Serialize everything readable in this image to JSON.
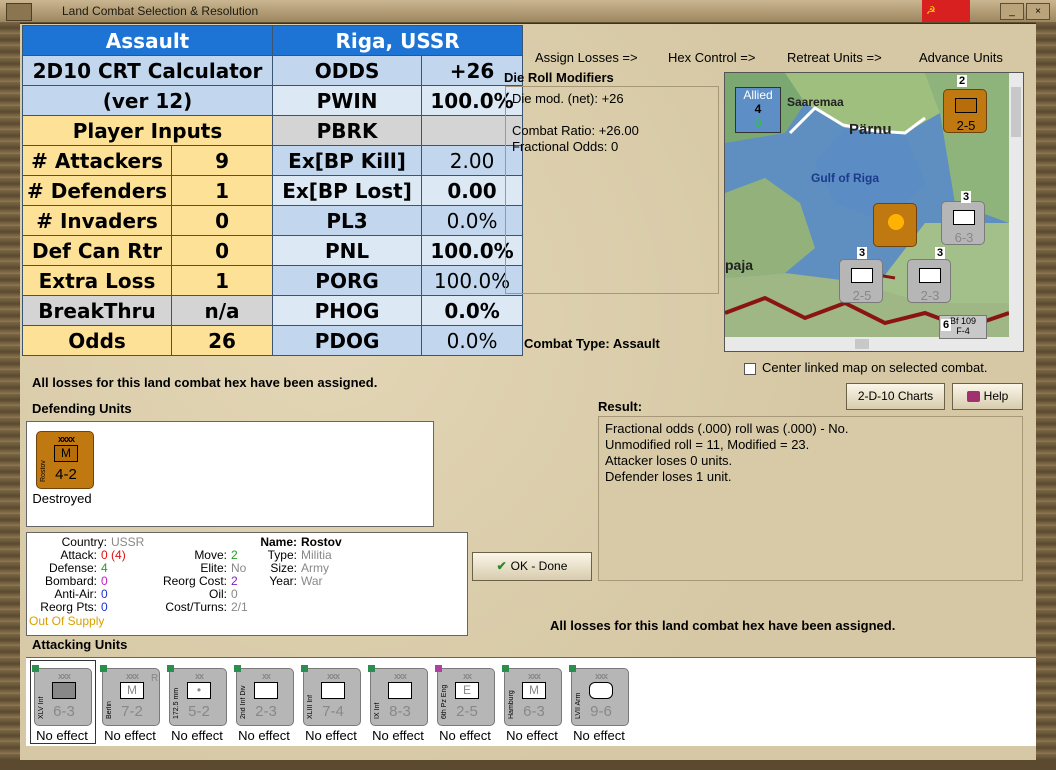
{
  "window": {
    "title": "Land Combat Selection & Resolution"
  },
  "crt": {
    "assault": "Assault",
    "location": "Riga, USSR",
    "title1": "2D10 CRT Calculator",
    "title2": "(ver 12)",
    "player_inputs": "Player Inputs",
    "left_rows": [
      {
        "label": "# Attackers",
        "value": "9"
      },
      {
        "label": "# Defenders",
        "value": "1"
      },
      {
        "label": "# Invaders",
        "value": "0"
      },
      {
        "label": "Def Can Rtr",
        "value": "0"
      },
      {
        "label": "Extra Loss",
        "value": "1"
      },
      {
        "label": "BreakThru",
        "value": "n/a"
      },
      {
        "label": "Odds",
        "value": "26"
      }
    ],
    "right_rows": [
      {
        "label": "ODDS",
        "value": "+26"
      },
      {
        "label": "PWIN",
        "value": "100.0%"
      },
      {
        "label": "PBRK",
        "value": ""
      },
      {
        "label": "Ex[BP Kill]",
        "value": "2.00"
      },
      {
        "label": "Ex[BP Lost]",
        "value": "0.00"
      },
      {
        "label": "PL3",
        "value": "0.0%"
      },
      {
        "label": "PNL",
        "value": "100.0%"
      },
      {
        "label": "PORG",
        "value": "100.0%"
      },
      {
        "label": "PHOG",
        "value": "0.0%"
      },
      {
        "label": "PDOG",
        "value": "0.0%"
      }
    ]
  },
  "links": [
    "Assign Losses =>",
    "Hex Control =>",
    "Retreat Units =>",
    "Advance Units"
  ],
  "die_roll": {
    "title": "Die Roll Modifiers",
    "lines": [
      "Die mod. (net): +26",
      "",
      "Combat Ratio: +26.00",
      "Fractional Odds: 0"
    ]
  },
  "map": {
    "allied_label": "Allied",
    "allied_num": "4",
    "allied_sub": "0",
    "places": [
      "Saaremaa",
      "Pärnu",
      "Gulf of Riga",
      "paja"
    ],
    "counters": [
      {
        "top": "2nd Gds",
        "str": "2-5"
      },
      {
        "top": "XLV Inf",
        "str": "6-3"
      },
      {
        "top": "6th Pz Eng",
        "str": "2-5"
      },
      {
        "top": "2nd Inf Div",
        "str": "2-3"
      },
      {
        "top": "Bf 109",
        "str": "F-4"
      }
    ],
    "stack_nums": [
      "2",
      "3",
      "3",
      "3",
      "6"
    ]
  },
  "combat_type": "Combat Type:  Assault",
  "center_checkbox": "Center linked map on selected combat.",
  "losses_msg": "All losses for this land combat hex have been assigned.",
  "buttons": {
    "charts": "2-D-10 Charts",
    "help": "Help",
    "ok": "OK - Done"
  },
  "defending": {
    "title": "Defending Units",
    "unit": {
      "side": "Rostov",
      "size": "xxxx",
      "symbol": "M",
      "str": "4-2",
      "status": "Destroyed"
    }
  },
  "result": {
    "title": "Result:",
    "lines": [
      "Fractional odds (.000) roll was (.000)  - No.",
      "Unmodified roll = 11, Modified = 23.",
      "Attacker loses 0 units.",
      "Defender loses 1 unit."
    ]
  },
  "info": {
    "country_l": "Country:",
    "country_v": "USSR",
    "attack_l": "Attack:",
    "attack_v": "0",
    "attack_v2": "(4)",
    "defense_l": "Defense:",
    "defense_v": "4",
    "bombard_l": "Bombard:",
    "bombard_v": "0",
    "antiair_l": "Anti-Air:",
    "antiair_v": "0",
    "reorgpts_l": "Reorg Pts:",
    "reorgpts_v": "0",
    "supply": "Out Of Supply",
    "move_l": "Move:",
    "move_v": "2",
    "elite_l": "Elite:",
    "elite_v": "No",
    "reorgcost_l": "Reorg Cost:",
    "reorgcost_v": "2",
    "oil_l": "Oil:",
    "oil_v": "0",
    "costturns_l": "Cost/Turns:",
    "costturns_v": "2/1",
    "name_l": "Name:",
    "name_v": "Rostov",
    "type_l": "Type:",
    "type_v": "Militia",
    "size_l": "Size:",
    "size_v": "Army",
    "year_l": "Year:",
    "year_v": "War"
  },
  "attacking": {
    "title": "Attacking Units",
    "units": [
      {
        "side": "XLV Inf",
        "size": "xxx",
        "symbol": "X",
        "str": "6-3",
        "status": "No effect"
      },
      {
        "side": "Berlin",
        "size": "xxx",
        "symbol": "M",
        "str": "7-2",
        "status": "No effect",
        "tag": "R"
      },
      {
        "side": "172.5 mm",
        "size": "xx",
        "symbol": "•",
        "str": "5-2",
        "status": "No effect"
      },
      {
        "side": "2nd Inf Div",
        "size": "xx",
        "symbol": "X",
        "str": "2-3",
        "status": "No effect"
      },
      {
        "side": "XLIII Inf",
        "size": "xxx",
        "symbol": "X",
        "str": "7-4",
        "status": "No effect"
      },
      {
        "side": "IX Inf",
        "size": "xxx",
        "symbol": "X",
        "str": "8-3",
        "status": "No effect"
      },
      {
        "side": "6th Pz Eng",
        "size": "xx",
        "symbol": "E",
        "str": "2-5",
        "status": "No effect"
      },
      {
        "side": "Hamburg",
        "size": "xxx",
        "symbol": "M",
        "str": "6-3",
        "status": "No effect"
      },
      {
        "side": "LVII Arm",
        "size": "xxx",
        "symbol": "O",
        "str": "9-6",
        "status": "No effect"
      }
    ]
  }
}
